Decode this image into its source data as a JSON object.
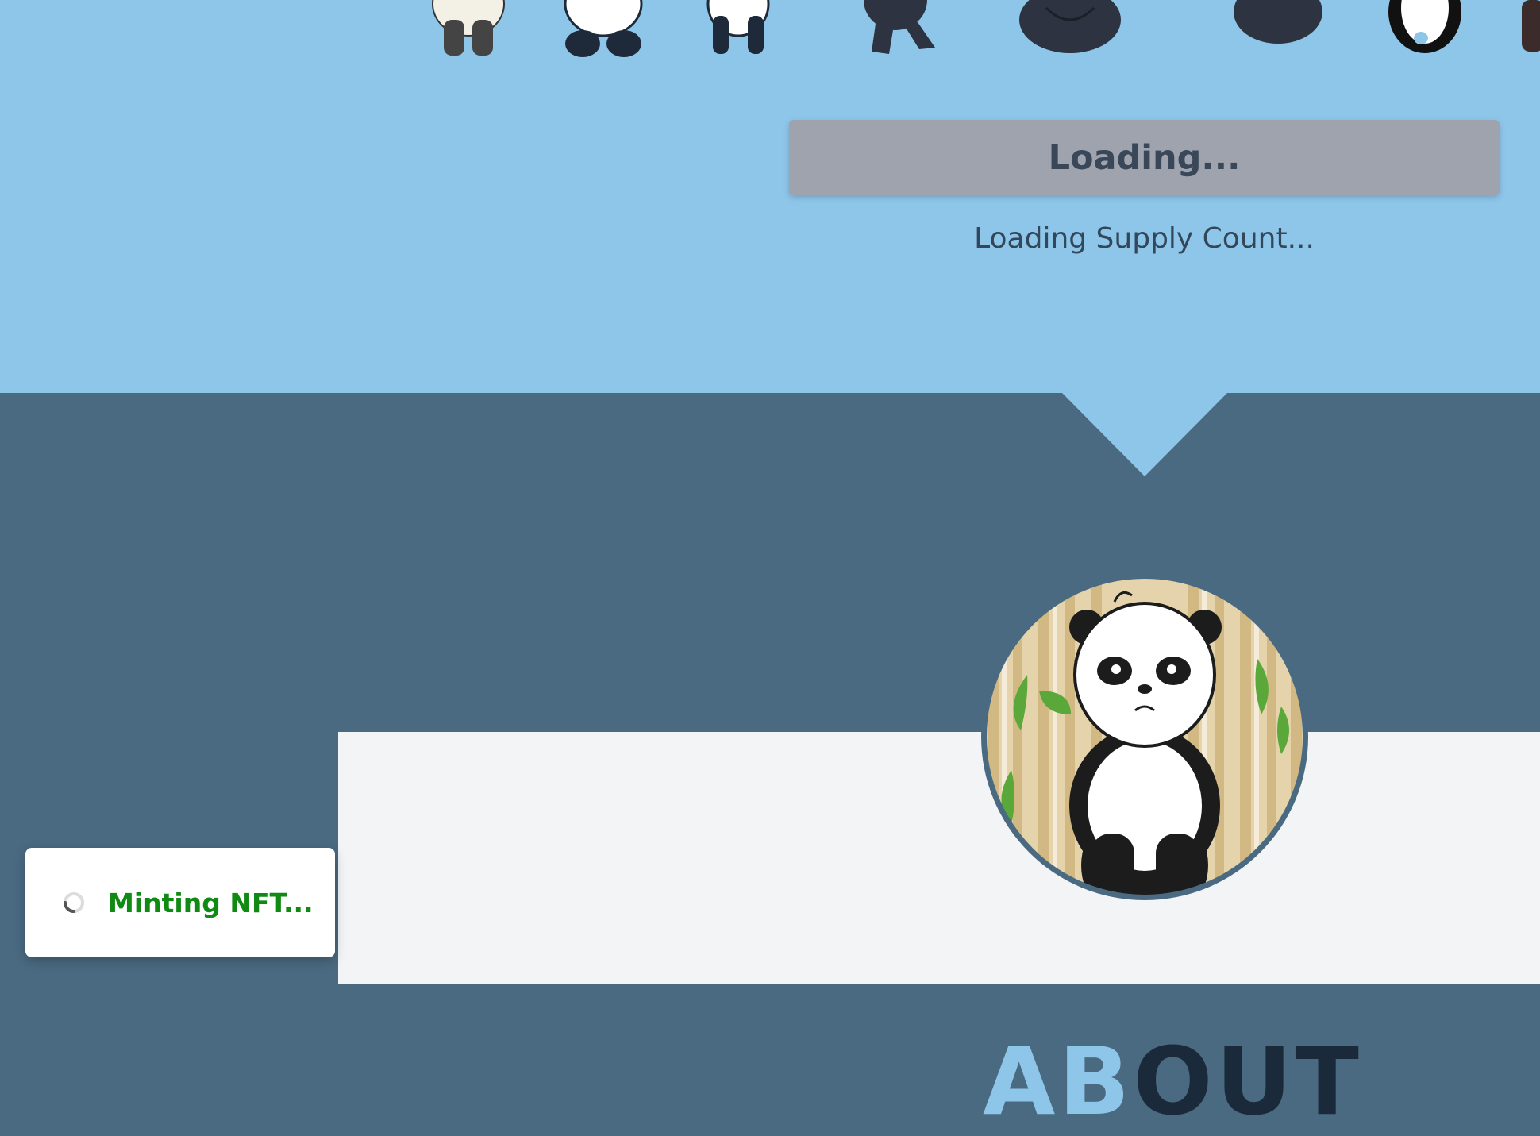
{
  "mint": {
    "button_label": "Loading...",
    "supply_status": "Loading Supply Count..."
  },
  "about": {
    "heading_accent": "AB",
    "heading_rest": "OUT"
  },
  "toast": {
    "message": "Minting NFT..."
  },
  "colors": {
    "hero_background": "#8ec6ea",
    "section_background": "#4a6a82",
    "panel_background": "#f2f4f6",
    "button_background": "#9ea3ae",
    "toast_text": "#0f8a12"
  },
  "icons": [
    "panda-illustration",
    "loading-spinner-icon",
    "panda-avatar"
  ]
}
